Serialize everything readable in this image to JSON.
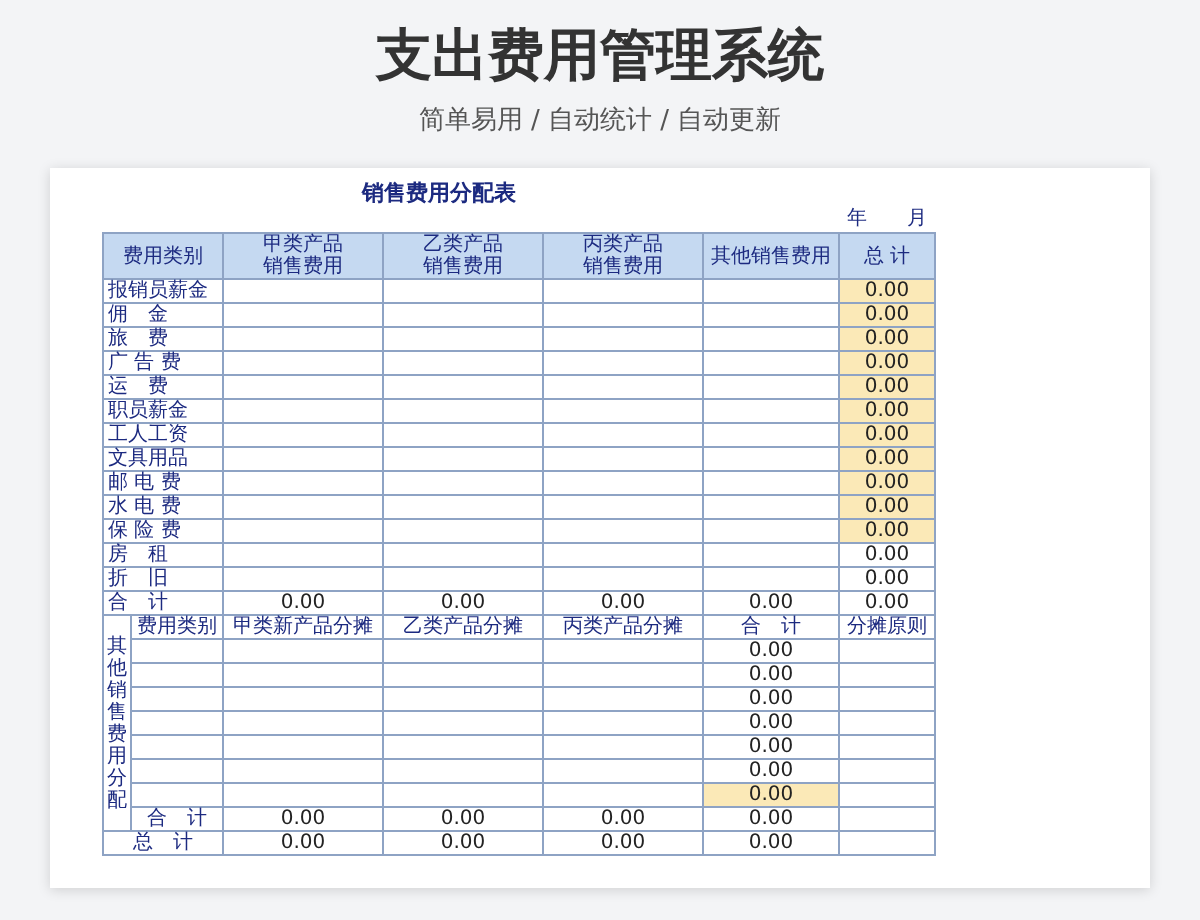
{
  "header": {
    "title": "支出费用管理系统",
    "subtitle": "简单易用 / 自动统计 / 自动更新"
  },
  "sheet": {
    "title": "销售费用分配表",
    "year_label": "年",
    "month_label": "月",
    "columns": [
      {
        "lines": [
          "费用类别"
        ]
      },
      {
        "lines": [
          "甲类产品",
          "销售费用"
        ]
      },
      {
        "lines": [
          "乙类产品",
          "销售费用"
        ]
      },
      {
        "lines": [
          "丙类产品",
          "销售费用"
        ]
      },
      {
        "lines": [
          "其他销售费用"
        ]
      },
      {
        "lines": [
          "总 计"
        ]
      }
    ],
    "rows": [
      {
        "label": "报销员薪金",
        "total": "0.00",
        "highlighted": true
      },
      {
        "label": "佣　金",
        "total": "0.00",
        "highlighted": true
      },
      {
        "label": "旅　费",
        "total": "0.00",
        "highlighted": true
      },
      {
        "label": "广 告 费",
        "total": "0.00",
        "highlighted": true
      },
      {
        "label": "运　费",
        "total": "0.00",
        "highlighted": true
      },
      {
        "label": "职员薪金",
        "total": "0.00",
        "highlighted": true
      },
      {
        "label": "工人工资",
        "total": "0.00",
        "highlighted": true
      },
      {
        "label": "文具用品",
        "total": "0.00",
        "highlighted": true
      },
      {
        "label": "邮 电 费",
        "total": "0.00",
        "highlighted": true
      },
      {
        "label": "水 电 费",
        "total": "0.00",
        "highlighted": true
      },
      {
        "label": "保 险 费",
        "total": "0.00",
        "highlighted": true
      },
      {
        "label": "房　租",
        "total": "0.00",
        "highlighted": false
      },
      {
        "label": "折　旧",
        "total": "0.00",
        "highlighted": false
      }
    ],
    "total_row": {
      "label": "合　计",
      "values": [
        "0.00",
        "0.00",
        "0.00",
        "0.00",
        "0.00"
      ]
    },
    "allocation": {
      "side_label": "其他销售费用分配",
      "columns": [
        "费用类别",
        "甲类新产品分摊",
        "乙类产品分摊",
        "丙类产品分摊",
        "合　计",
        "分摊原则"
      ],
      "rows": [
        {
          "total": "0.00",
          "highlighted": false
        },
        {
          "total": "0.00",
          "highlighted": false
        },
        {
          "total": "0.00",
          "highlighted": false
        },
        {
          "total": "0.00",
          "highlighted": false
        },
        {
          "total": "0.00",
          "highlighted": false
        },
        {
          "total": "0.00",
          "highlighted": false
        },
        {
          "total": "0.00",
          "highlighted": true
        }
      ],
      "subtotal": {
        "label": "合　计",
        "values": [
          "0.00",
          "0.00",
          "0.00",
          "0.00"
        ]
      },
      "grand_total": {
        "label": "总　计",
        "values": [
          "0.00",
          "0.00",
          "0.00",
          "0.00"
        ]
      }
    }
  }
}
